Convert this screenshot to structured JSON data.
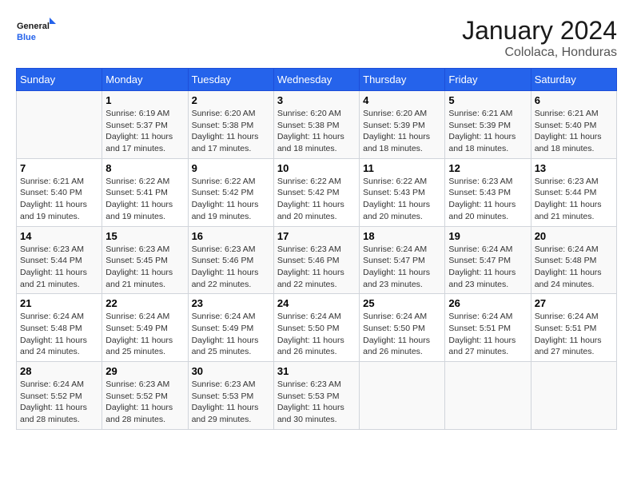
{
  "header": {
    "logo_general": "General",
    "logo_blue": "Blue",
    "month": "January 2024",
    "location": "Cololaca, Honduras"
  },
  "days_of_week": [
    "Sunday",
    "Monday",
    "Tuesday",
    "Wednesday",
    "Thursday",
    "Friday",
    "Saturday"
  ],
  "weeks": [
    [
      {
        "day": "",
        "info": ""
      },
      {
        "day": "1",
        "info": "Sunrise: 6:19 AM\nSunset: 5:37 PM\nDaylight: 11 hours\nand 17 minutes."
      },
      {
        "day": "2",
        "info": "Sunrise: 6:20 AM\nSunset: 5:38 PM\nDaylight: 11 hours\nand 17 minutes."
      },
      {
        "day": "3",
        "info": "Sunrise: 6:20 AM\nSunset: 5:38 PM\nDaylight: 11 hours\nand 18 minutes."
      },
      {
        "day": "4",
        "info": "Sunrise: 6:20 AM\nSunset: 5:39 PM\nDaylight: 11 hours\nand 18 minutes."
      },
      {
        "day": "5",
        "info": "Sunrise: 6:21 AM\nSunset: 5:39 PM\nDaylight: 11 hours\nand 18 minutes."
      },
      {
        "day": "6",
        "info": "Sunrise: 6:21 AM\nSunset: 5:40 PM\nDaylight: 11 hours\nand 18 minutes."
      }
    ],
    [
      {
        "day": "7",
        "info": "Sunrise: 6:21 AM\nSunset: 5:40 PM\nDaylight: 11 hours\nand 19 minutes."
      },
      {
        "day": "8",
        "info": "Sunrise: 6:22 AM\nSunset: 5:41 PM\nDaylight: 11 hours\nand 19 minutes."
      },
      {
        "day": "9",
        "info": "Sunrise: 6:22 AM\nSunset: 5:42 PM\nDaylight: 11 hours\nand 19 minutes."
      },
      {
        "day": "10",
        "info": "Sunrise: 6:22 AM\nSunset: 5:42 PM\nDaylight: 11 hours\nand 20 minutes."
      },
      {
        "day": "11",
        "info": "Sunrise: 6:22 AM\nSunset: 5:43 PM\nDaylight: 11 hours\nand 20 minutes."
      },
      {
        "day": "12",
        "info": "Sunrise: 6:23 AM\nSunset: 5:43 PM\nDaylight: 11 hours\nand 20 minutes."
      },
      {
        "day": "13",
        "info": "Sunrise: 6:23 AM\nSunset: 5:44 PM\nDaylight: 11 hours\nand 21 minutes."
      }
    ],
    [
      {
        "day": "14",
        "info": "Sunrise: 6:23 AM\nSunset: 5:44 PM\nDaylight: 11 hours\nand 21 minutes."
      },
      {
        "day": "15",
        "info": "Sunrise: 6:23 AM\nSunset: 5:45 PM\nDaylight: 11 hours\nand 21 minutes."
      },
      {
        "day": "16",
        "info": "Sunrise: 6:23 AM\nSunset: 5:46 PM\nDaylight: 11 hours\nand 22 minutes."
      },
      {
        "day": "17",
        "info": "Sunrise: 6:23 AM\nSunset: 5:46 PM\nDaylight: 11 hours\nand 22 minutes."
      },
      {
        "day": "18",
        "info": "Sunrise: 6:24 AM\nSunset: 5:47 PM\nDaylight: 11 hours\nand 23 minutes."
      },
      {
        "day": "19",
        "info": "Sunrise: 6:24 AM\nSunset: 5:47 PM\nDaylight: 11 hours\nand 23 minutes."
      },
      {
        "day": "20",
        "info": "Sunrise: 6:24 AM\nSunset: 5:48 PM\nDaylight: 11 hours\nand 24 minutes."
      }
    ],
    [
      {
        "day": "21",
        "info": "Sunrise: 6:24 AM\nSunset: 5:48 PM\nDaylight: 11 hours\nand 24 minutes."
      },
      {
        "day": "22",
        "info": "Sunrise: 6:24 AM\nSunset: 5:49 PM\nDaylight: 11 hours\nand 25 minutes."
      },
      {
        "day": "23",
        "info": "Sunrise: 6:24 AM\nSunset: 5:49 PM\nDaylight: 11 hours\nand 25 minutes."
      },
      {
        "day": "24",
        "info": "Sunrise: 6:24 AM\nSunset: 5:50 PM\nDaylight: 11 hours\nand 26 minutes."
      },
      {
        "day": "25",
        "info": "Sunrise: 6:24 AM\nSunset: 5:50 PM\nDaylight: 11 hours\nand 26 minutes."
      },
      {
        "day": "26",
        "info": "Sunrise: 6:24 AM\nSunset: 5:51 PM\nDaylight: 11 hours\nand 27 minutes."
      },
      {
        "day": "27",
        "info": "Sunrise: 6:24 AM\nSunset: 5:51 PM\nDaylight: 11 hours\nand 27 minutes."
      }
    ],
    [
      {
        "day": "28",
        "info": "Sunrise: 6:24 AM\nSunset: 5:52 PM\nDaylight: 11 hours\nand 28 minutes."
      },
      {
        "day": "29",
        "info": "Sunrise: 6:23 AM\nSunset: 5:52 PM\nDaylight: 11 hours\nand 28 minutes."
      },
      {
        "day": "30",
        "info": "Sunrise: 6:23 AM\nSunset: 5:53 PM\nDaylight: 11 hours\nand 29 minutes."
      },
      {
        "day": "31",
        "info": "Sunrise: 6:23 AM\nSunset: 5:53 PM\nDaylight: 11 hours\nand 30 minutes."
      },
      {
        "day": "",
        "info": ""
      },
      {
        "day": "",
        "info": ""
      },
      {
        "day": "",
        "info": ""
      }
    ]
  ]
}
